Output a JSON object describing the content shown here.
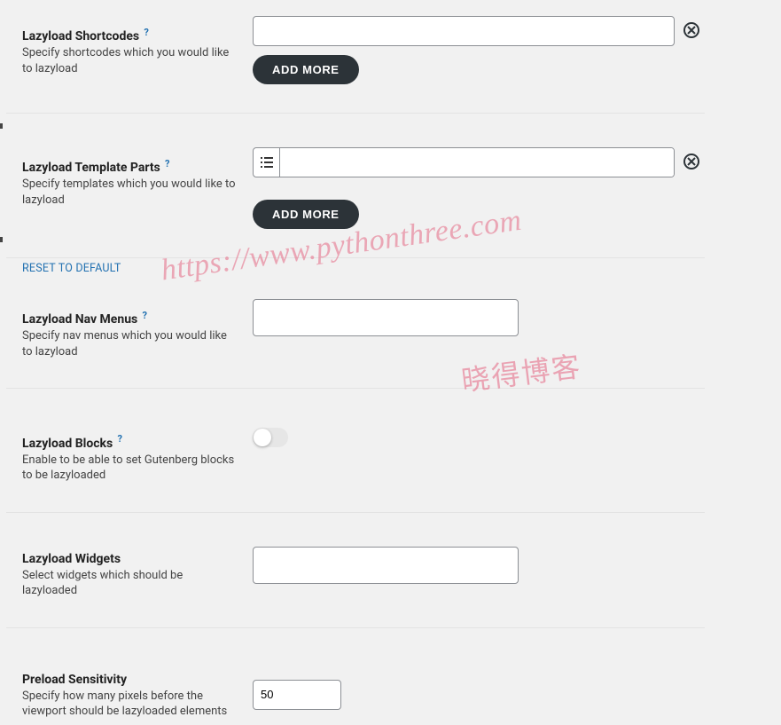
{
  "rows": {
    "shortcodes": {
      "title": "Lazyload Shortcodes",
      "desc": "Specify shortcodes which you would like to lazyload",
      "value": "",
      "add_more": "ADD MORE"
    },
    "template_parts": {
      "title": "Lazyload Template Parts",
      "desc": "Specify templates which you would like to lazyload",
      "value": "",
      "add_more": "ADD MORE"
    },
    "nav_menus": {
      "reset": "RESET TO DEFAULT",
      "title": "Lazyload Nav Menus",
      "desc": "Specify nav menus which you would like to lazyload"
    },
    "blocks": {
      "title": "Lazyload Blocks",
      "desc": "Enable to be able to set Gutenberg blocks to be lazyloaded",
      "toggle": false
    },
    "widgets": {
      "title": "Lazyload Widgets",
      "desc": "Select widgets which should be lazyloaded"
    },
    "preload": {
      "title": "Preload Sensitivity",
      "desc": "Specify how many pixels before the viewport should be lazyloaded elements",
      "value": "50"
    }
  },
  "icons": {
    "help": "?",
    "remove": "✕",
    "list": "≣"
  },
  "watermark": {
    "url": "https://www.pythonthree.com",
    "name": "晓得博客"
  }
}
